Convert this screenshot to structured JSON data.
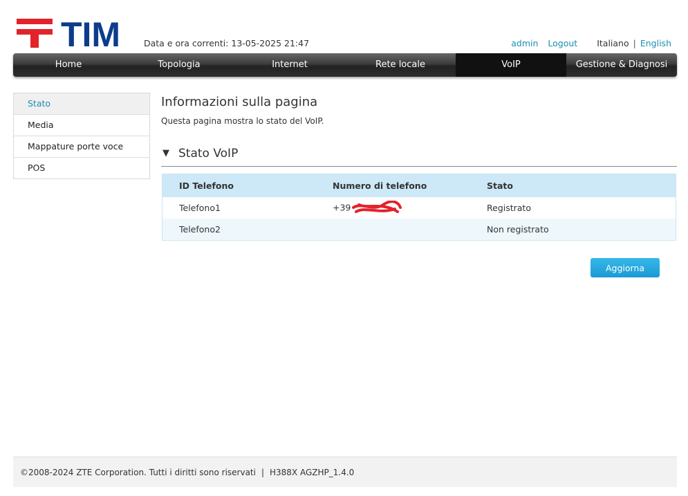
{
  "brand": {
    "name": "TIM",
    "primary_color": "#0c3c8b",
    "accent_color": "#e3222a"
  },
  "header": {
    "datetime": "Data e ora correnti: 13-05-2025 21:47",
    "user": "admin",
    "logout": "Logout",
    "lang_current": "Italiano",
    "lang_sep": "|",
    "lang_other": "English"
  },
  "nav": {
    "tabs": [
      {
        "label": "Home"
      },
      {
        "label": "Topologia"
      },
      {
        "label": "Internet"
      },
      {
        "label": "Rete locale"
      },
      {
        "label": "VoIP",
        "active": true
      },
      {
        "label": "Gestione & Diagnosi"
      }
    ]
  },
  "sidebar": {
    "items": [
      {
        "label": "Stato",
        "active": true
      },
      {
        "label": "Media"
      },
      {
        "label": "Mappature porte voce"
      },
      {
        "label": "POS"
      }
    ]
  },
  "main": {
    "title": "Informazioni sulla pagina",
    "description": "Questa pagina mostra lo stato del VoIP.",
    "section_title": "Stato VoIP",
    "table": {
      "headers": [
        "ID Telefono",
        "Numero di telefono",
        "Stato"
      ],
      "rows": [
        [
          "Telefono1",
          "+39",
          "Registrato"
        ],
        [
          "Telefono2",
          "",
          "Non registrato"
        ]
      ]
    },
    "refresh_button": "Aggiorna"
  },
  "footer": {
    "copyright": "©2008-2024 ZTE Corporation. Tutti i diritti sono riservati",
    "sep": "|",
    "version": "H388X AGZHP_1.4.0"
  }
}
